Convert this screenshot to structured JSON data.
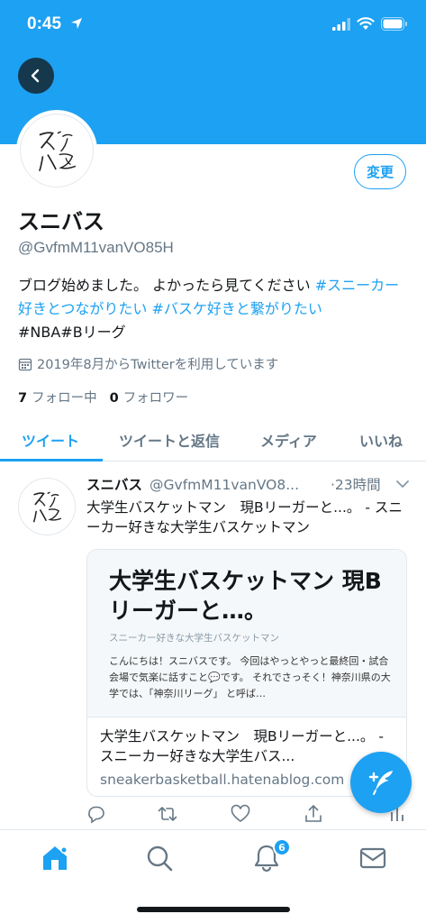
{
  "status": {
    "time": "0:45"
  },
  "profile": {
    "display_name": "スニバス",
    "handle": "@GvfmM11vanVO85H",
    "edit_label": "変更",
    "bio_text": "ブログ始めました。 よかったら見てください ",
    "bio_tags": [
      "#スニーカー好きとつながりたい",
      "#バスケ好きと繋がりたい",
      "#NBA#Bリーグ"
    ],
    "joined": "2019年8月からTwitterを利用しています",
    "following_count": "7",
    "following_label": "フォロー中",
    "followers_count": "0",
    "followers_label": "フォロワー"
  },
  "tabs": [
    "ツイート",
    "ツイートと返信",
    "メディア",
    "いいね"
  ],
  "tweet": {
    "name": "スニバス",
    "handle": "@GvfmM11vanVO8...",
    "time": "·23時間",
    "text": "大学生バスケットマン　現Bリーガーと...。 - スニーカー好きな大学生バスケットマン",
    "card": {
      "preview_title": "大学生バスケットマン 現Bリーガーと…。",
      "preview_site": "スニーカー好きな大学生バスケットマン",
      "preview_excerpt": "こんにちは！スニバスです。 今回はやっとやっと最終回・試合会場で気楽に話すこと💬です。 それでさっそく！神奈川県の大学では、「神奈川リーグ」 と呼ば…",
      "title": "大学生バスケットマン　現Bリーガーと...。 - スニーカー好きな大学生バス...",
      "domain": "sneakerbasketball.hatenablog.com"
    }
  },
  "notifications_badge": "6",
  "colors": {
    "accent": "#1da1f2",
    "text": "#14171a",
    "muted": "#657786"
  },
  "icons": [
    "back-arrow-icon",
    "calendar-icon",
    "chevron-down-icon",
    "reply-icon",
    "retweet-icon",
    "like-icon",
    "share-icon",
    "stats-icon",
    "compose-icon",
    "home-icon",
    "search-icon",
    "bell-icon",
    "mail-icon"
  ]
}
